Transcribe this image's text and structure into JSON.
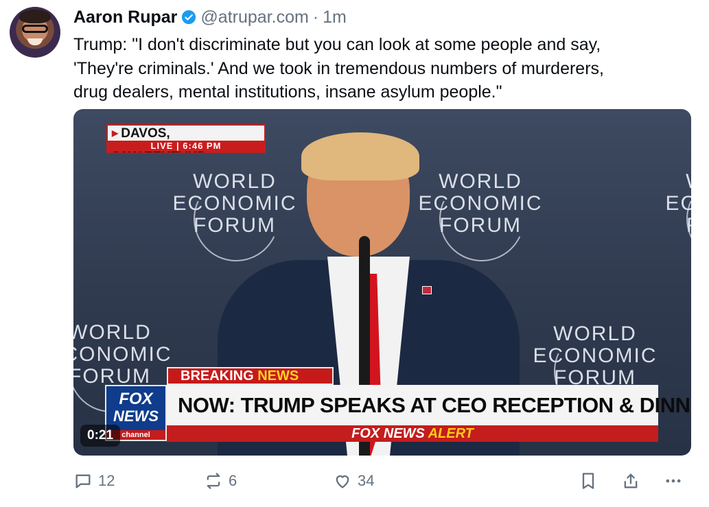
{
  "post": {
    "author_name": "Aaron Rupar",
    "handle": "@atrupar.com",
    "separator": "·",
    "time": "1m",
    "text": "Trump: \"I don't discriminate but you can look at some people and say,\n'They're criminals.' And we took in tremendous numbers of murderers,\ndrug dealers, mental institutions, insane asylum people.\""
  },
  "video": {
    "duration": "0:21",
    "dateline_location": "DAVOS, SWITZERLAND",
    "dateline_status": "LIVE | 6:46 PM",
    "breaking_label_1": "BREAKING ",
    "breaking_label_2": "NEWS",
    "headline": "NOW: TRUMP SPEAKS AT CEO RECEPTION & DINNER",
    "alert_label_1": "FOX NEWS ",
    "alert_label_2": "ALERT",
    "logo_line1": "FOX",
    "logo_line2": "NEWS",
    "logo_line3": "channel",
    "backdrop_line1": "WORLD",
    "backdrop_line2": "ECONOMIC",
    "backdrop_line3": "FORUM"
  },
  "actions": {
    "replies": "12",
    "reposts": "6",
    "likes": "34"
  },
  "icons": [
    "reply-icon",
    "repost-icon",
    "like-icon",
    "bookmark-icon",
    "share-icon",
    "more-icon",
    "verified-icon"
  ],
  "colors": {
    "verified": "#1d9bf0",
    "muted_text": "#66727f",
    "fox_red": "#c41d1d",
    "fox_blue": "#0f3c8c",
    "alert_yellow": "#ffcd19"
  }
}
